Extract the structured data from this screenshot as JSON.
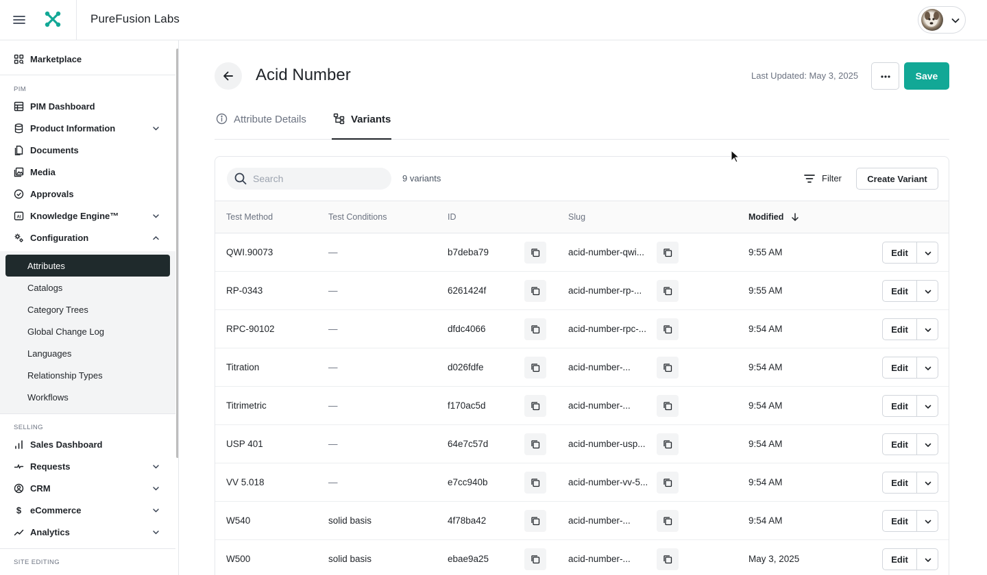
{
  "app": {
    "title": "PureFusion Labs"
  },
  "sidebar": {
    "marketplace": {
      "label": "Marketplace",
      "icon": "marketplace-icon"
    },
    "sections": {
      "pim": "PIM",
      "selling": "SELLING",
      "site_editing": "SITE EDITING"
    },
    "pim_items": [
      {
        "label": "PIM Dashboard",
        "icon": "table-icon"
      },
      {
        "label": "Product Information",
        "icon": "database-icon",
        "expandable": true
      },
      {
        "label": "Documents",
        "icon": "documents-icon"
      },
      {
        "label": "Media",
        "icon": "media-icon"
      },
      {
        "label": "Approvals",
        "icon": "approvals-icon"
      },
      {
        "label": "Knowledge Engine™",
        "icon": "ai-icon",
        "expandable": true
      },
      {
        "label": "Configuration",
        "icon": "configuration-icon",
        "expanded": true
      }
    ],
    "configuration_items": [
      {
        "label": "Attributes",
        "active": true
      },
      {
        "label": "Catalogs"
      },
      {
        "label": "Category Trees"
      },
      {
        "label": "Global Change Log"
      },
      {
        "label": "Languages"
      },
      {
        "label": "Relationship Types"
      },
      {
        "label": "Workflows"
      }
    ],
    "selling_items": [
      {
        "label": "Sales Dashboard",
        "icon": "bar-chart-icon"
      },
      {
        "label": "Requests",
        "icon": "requests-icon",
        "expandable": true
      },
      {
        "label": "CRM",
        "icon": "user-circle-icon",
        "expandable": true
      },
      {
        "label": "eCommerce",
        "icon": "dollar-icon",
        "expandable": true
      },
      {
        "label": "Analytics",
        "icon": "trend-icon",
        "expandable": true
      }
    ]
  },
  "page": {
    "title": "Acid Number",
    "last_updated": "Last Updated: May 3, 2025",
    "save_label": "Save",
    "accent_color": "#12a896"
  },
  "tabs": [
    {
      "label": "Attribute Details",
      "icon": "info-icon",
      "active": false
    },
    {
      "label": "Variants",
      "icon": "hierarchy-icon",
      "active": true
    }
  ],
  "toolbar": {
    "search_placeholder": "Search",
    "variant_count": "9 variants",
    "filter_label": "Filter",
    "create_label": "Create Variant"
  },
  "table": {
    "columns": [
      "Test Method",
      "Test Conditions",
      "ID",
      "Slug",
      "Modified"
    ],
    "sorted_column": "Modified",
    "sort_direction": "desc",
    "edit_label": "Edit",
    "rows": [
      {
        "method": "QWI.90073",
        "conditions": "—",
        "id": "b7deba79",
        "slug": "acid-number-qwi...",
        "modified": "9:55 AM"
      },
      {
        "method": "RP-0343",
        "conditions": "—",
        "id": "6261424f",
        "slug": "acid-number-rp-...",
        "modified": "9:55 AM"
      },
      {
        "method": "RPC-90102",
        "conditions": "—",
        "id": "dfdc4066",
        "slug": "acid-number-rpc-...",
        "modified": "9:54 AM"
      },
      {
        "method": "Titration",
        "conditions": "—",
        "id": "d026fdfe",
        "slug": "acid-number-...",
        "modified": "9:54 AM"
      },
      {
        "method": "Titrimetric",
        "conditions": "—",
        "id": "f170ac5d",
        "slug": "acid-number-...",
        "modified": "9:54 AM"
      },
      {
        "method": "USP 401",
        "conditions": "—",
        "id": "64e7c57d",
        "slug": "acid-number-usp...",
        "modified": "9:54 AM"
      },
      {
        "method": "VV 5.018",
        "conditions": "—",
        "id": "e7cc940b",
        "slug": "acid-number-vv-5...",
        "modified": "9:54 AM"
      },
      {
        "method": "W540",
        "conditions": "solid basis",
        "id": "4f78ba42",
        "slug": "acid-number-...",
        "modified": "9:54 AM"
      },
      {
        "method": "W500",
        "conditions": "solid basis",
        "id": "ebae9a25",
        "slug": "acid-number-...",
        "modified": "May 3, 2025"
      }
    ]
  }
}
